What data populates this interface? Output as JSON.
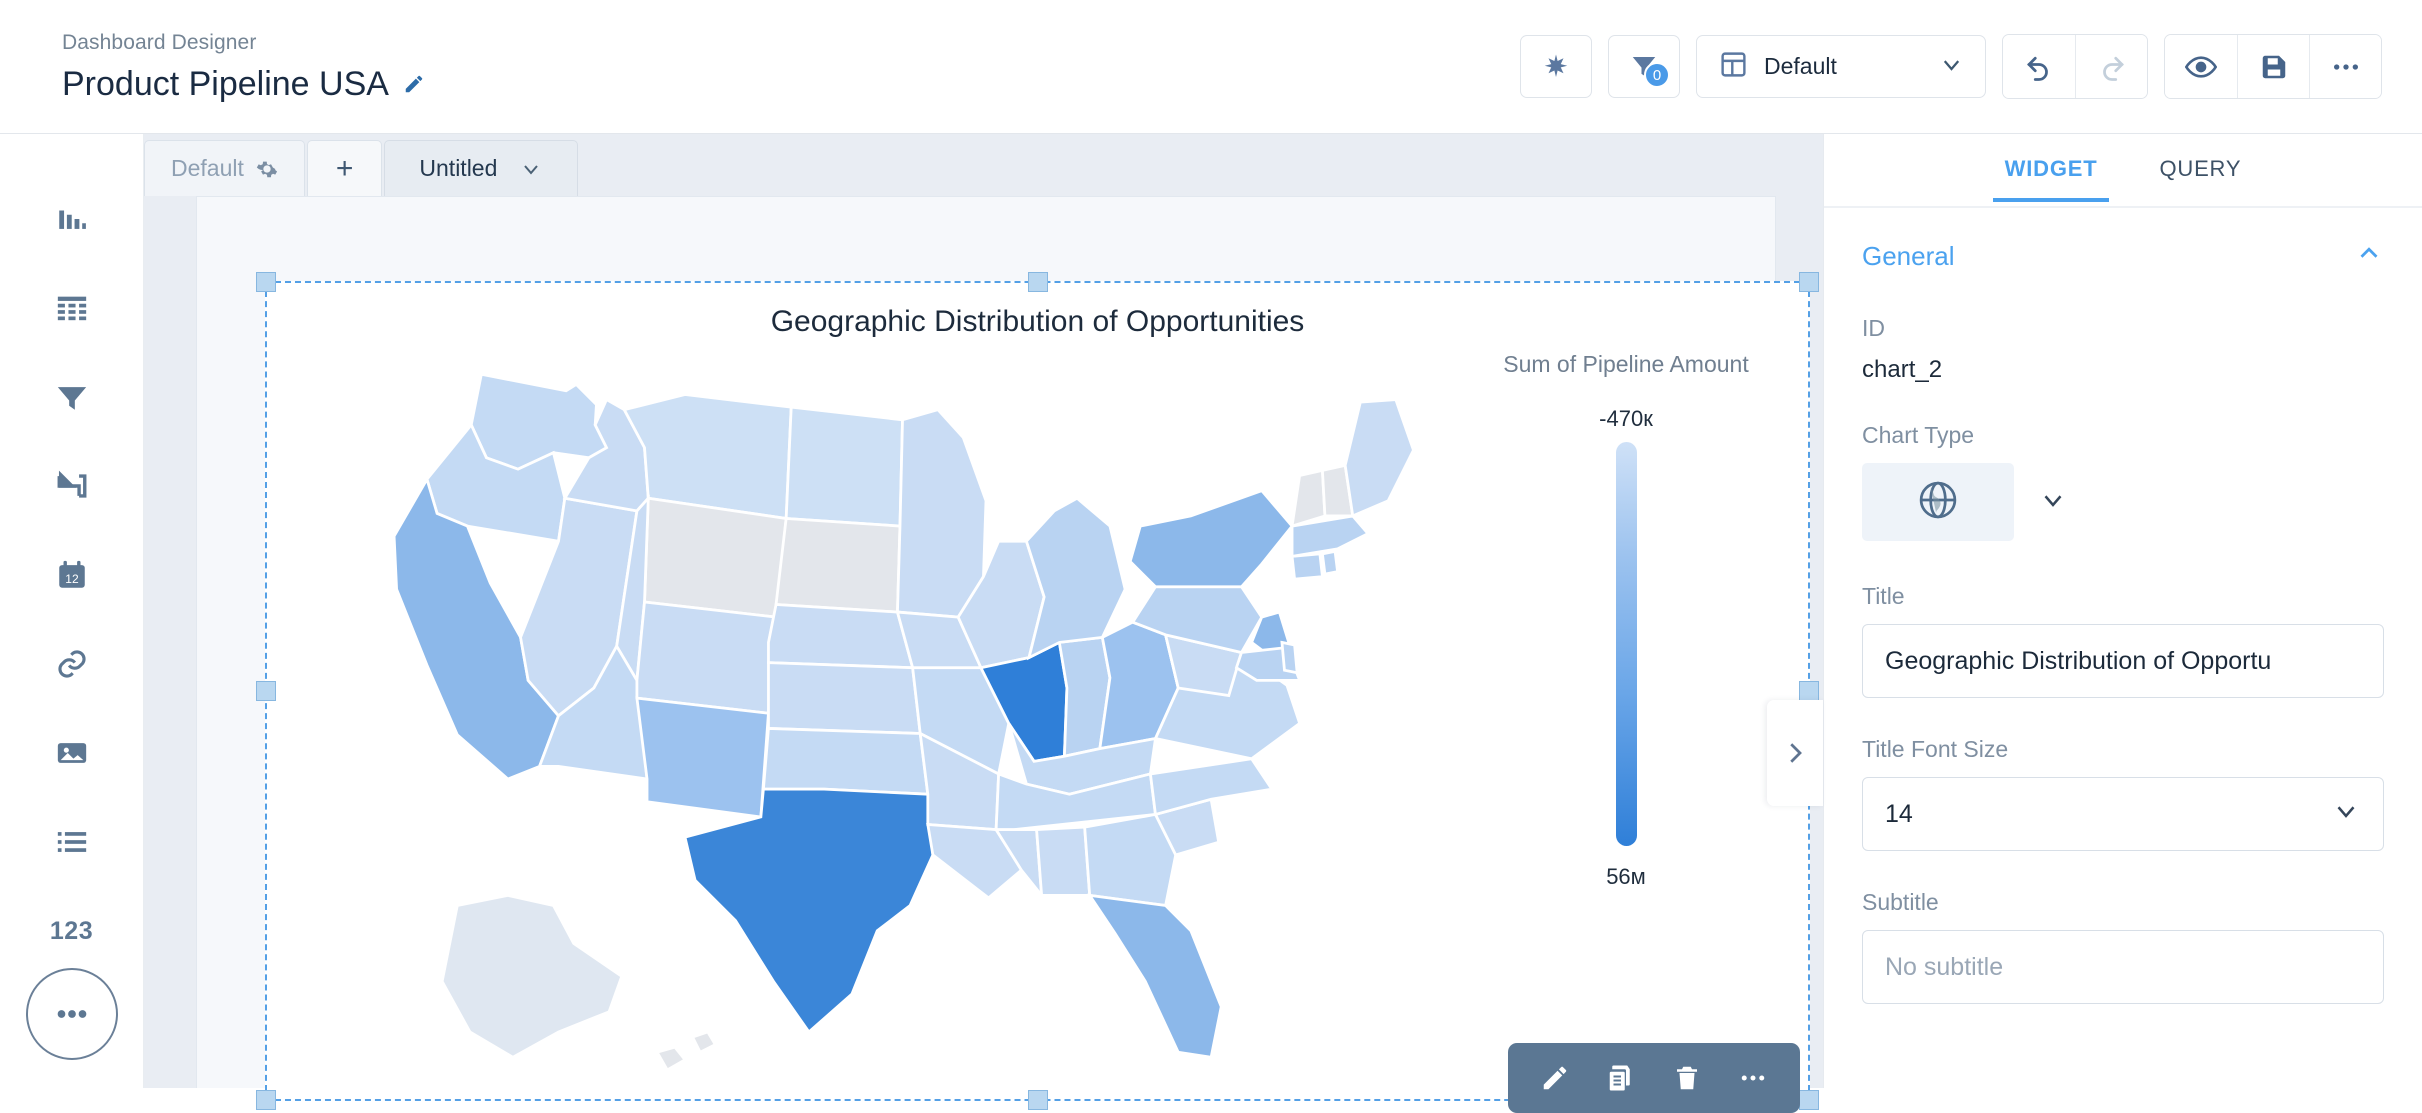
{
  "header": {
    "breadcrumb": "Dashboard Designer",
    "title": "Product Pipeline USA",
    "edit_icon": "pencil-icon",
    "tools": {
      "ai_label": "sparkle-icon",
      "filter_label": "filter-icon",
      "filter_badge": "0",
      "layout_label": "Default",
      "layout_icon": "layout-grid-icon",
      "undo_label": "undo-icon",
      "redo_label": "redo-icon",
      "preview_label": "eye-icon",
      "save_label": "save-icon",
      "more_label": "more-horizontal-icon"
    }
  },
  "rail": {
    "items": [
      {
        "name": "chart-widget",
        "icon": "bar-chart-icon"
      },
      {
        "name": "table-widget",
        "icon": "table-icon"
      },
      {
        "name": "filter-widget",
        "icon": "filter-icon"
      },
      {
        "name": "input-widget",
        "icon": "input-arrow-icon"
      },
      {
        "name": "date-widget",
        "icon": "calendar-12-icon"
      },
      {
        "name": "link-widget",
        "icon": "link-icon"
      },
      {
        "name": "image-widget",
        "icon": "image-icon"
      },
      {
        "name": "list-widget",
        "icon": "list-icon"
      },
      {
        "name": "number-widget",
        "icon": "123-icon",
        "text": "123"
      }
    ],
    "fab": "more-options-icon"
  },
  "tabs": {
    "default_label": "Default",
    "default_icon": "gear-icon",
    "add_label": "+",
    "active_label": "Untitled",
    "active_icon": "chevron-down-icon"
  },
  "widget": {
    "chart_title": "Geographic Distribution of Opportunities",
    "actions": {
      "edit": "pencil-icon",
      "duplicate": "copy-icon",
      "delete": "trash-icon",
      "more": "more-horizontal-icon"
    },
    "collapse_icon": "chevron-right-icon"
  },
  "panel": {
    "tabs": [
      {
        "label": "WIDGET",
        "active": true
      },
      {
        "label": "QUERY",
        "active": false
      }
    ],
    "tab_widget": "WIDGET",
    "tab_query": "QUERY",
    "section_title": "General",
    "section_chevron": "chevron-up-icon",
    "id_label": "ID",
    "id_value": "chart_2",
    "chart_type_label": "Chart Type",
    "chart_type_icon": "globe-icon",
    "chart_type_chevron": "chevron-down-icon",
    "title_label": "Title",
    "title_value": "Geographic Distribution of Opportu",
    "title_font_size_label": "Title Font Size",
    "title_font_size_value": "14",
    "subtitle_label": "Subtitle",
    "subtitle_placeholder": "No subtitle"
  },
  "chart_data": {
    "type": "heatmap",
    "title": "Geographic Distribution of Opportunities",
    "legend_title": "Sum of Pipeline Amount",
    "legend_max_label": "-470к",
    "legend_min_label": "56м",
    "legend_position": "right",
    "color_scale": [
      "#cfe1f7",
      "#9dc3ef",
      "#6aa6e8",
      "#2f7fd8"
    ],
    "no_data_color": "#e3e6eb",
    "region": "USA states",
    "states": [
      {
        "code": "TX",
        "name": "Texas",
        "value": 56000000,
        "color": "#3b86d8"
      },
      {
        "code": "IL",
        "name": "Illinois",
        "value": 48000000,
        "color": "#2f7fd8"
      },
      {
        "code": "CA",
        "name": "California",
        "value": 30000000,
        "color": "#8cb8ea"
      },
      {
        "code": "FL",
        "name": "Florida",
        "value": 28000000,
        "color": "#8cb8ea"
      },
      {
        "code": "NY",
        "name": "New York",
        "value": 26000000,
        "color": "#8cb8ea"
      },
      {
        "code": "OH",
        "name": "Ohio",
        "value": 24000000,
        "color": "#9cc2ef"
      },
      {
        "code": "NJ",
        "name": "New Jersey",
        "value": 22000000,
        "color": "#8cb8ea"
      },
      {
        "code": "NM",
        "name": "New Mexico",
        "value": 20000000,
        "color": "#9cc2ef"
      },
      {
        "code": "PA",
        "name": "Pennsylvania",
        "value": 16000000,
        "color": "#b9d3f2"
      },
      {
        "code": "MI",
        "name": "Michigan",
        "value": 15000000,
        "color": "#b9d3f2"
      },
      {
        "code": "VA",
        "name": "Virginia",
        "value": 14000000,
        "color": "#c4daf4"
      },
      {
        "code": "NC",
        "name": "North Carolina",
        "value": 13000000,
        "color": "#c4daf4"
      },
      {
        "code": "GA",
        "name": "Georgia",
        "value": 13000000,
        "color": "#c4daf4"
      },
      {
        "code": "WA",
        "name": "Washington",
        "value": 12000000,
        "color": "#c4daf4"
      },
      {
        "code": "MA",
        "name": "Massachusetts",
        "value": 11000000,
        "color": "#b9d3f2"
      },
      {
        "code": "WY",
        "name": "Wyoming",
        "value": null,
        "color": "#e3e6eb"
      },
      {
        "code": "SD",
        "name": "South Dakota",
        "value": null,
        "color": "#e3e6eb"
      },
      {
        "code": "VT",
        "name": "Vermont",
        "value": null,
        "color": "#e3e6eb"
      },
      {
        "code": "NH",
        "name": "New Hampshire",
        "value": null,
        "color": "#e3e6eb"
      }
    ]
  }
}
